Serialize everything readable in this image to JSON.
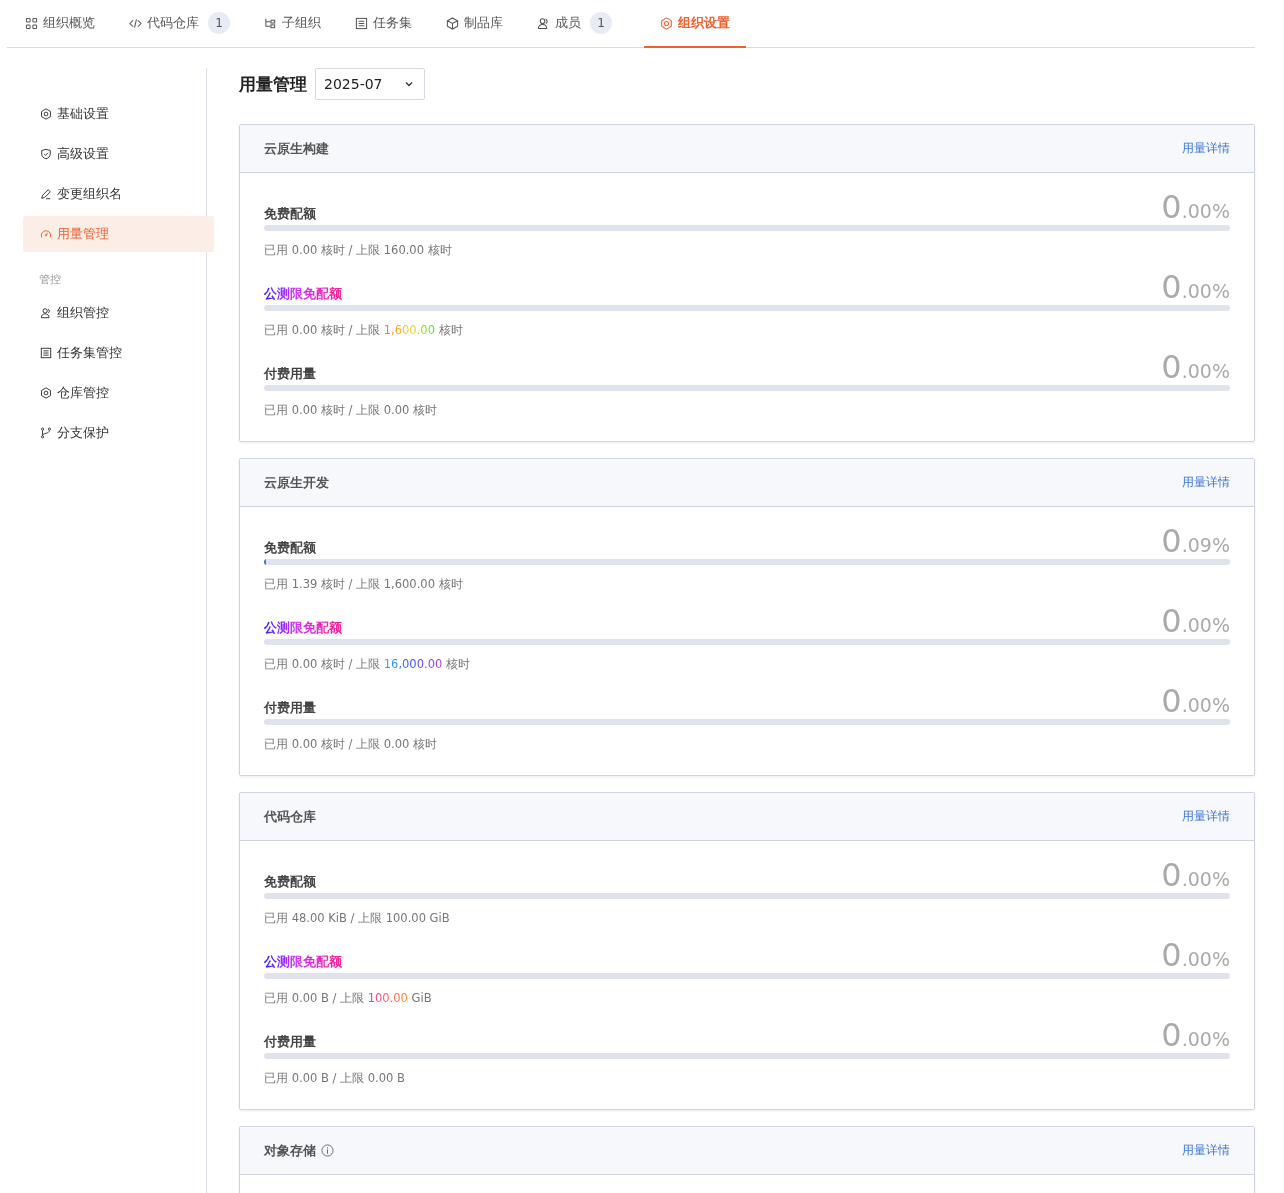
{
  "tabs": [
    {
      "label": "组织概览",
      "selected": false
    },
    {
      "label": "代码仓库",
      "count": "1",
      "selected": false
    },
    {
      "label": "子组织",
      "selected": false
    },
    {
      "label": "任务集",
      "selected": false
    },
    {
      "label": "制品库",
      "selected": false
    },
    {
      "label": "成员",
      "count": "1",
      "selected": false
    },
    {
      "label": "组织设置",
      "selected": true
    }
  ],
  "sidebar": {
    "items": [
      {
        "kind": "item",
        "label": "基础设置",
        "selected": false
      },
      {
        "kind": "item",
        "label": "高级设置",
        "selected": false
      },
      {
        "kind": "item",
        "label": "变更组织名",
        "selected": false
      },
      {
        "kind": "item",
        "label": "用量管理",
        "selected": true
      },
      {
        "kind": "group",
        "label": "管控"
      },
      {
        "kind": "item",
        "label": "组织管控",
        "selected": false
      },
      {
        "kind": "item",
        "label": "任务集管控",
        "selected": false
      },
      {
        "kind": "item",
        "label": "仓库管控",
        "selected": false
      },
      {
        "kind": "item",
        "label": "分支保护",
        "selected": false
      }
    ]
  },
  "page": {
    "title": "用量管理",
    "month": "2025-07"
  },
  "cards": [
    {
      "title": "云原生构建",
      "link": "用量详情",
      "rows": [
        {
          "kind": "standard",
          "label": "免费配额",
          "percent_int": "0",
          "percent_frac": ".00%",
          "level": 0,
          "used": "已用 0.00 核时 / 上限",
          "limit": "160.00",
          "unit": "核时"
        },
        {
          "kind": "promo",
          "label": "公测限免配额",
          "percent_int": "0",
          "percent_frac": ".00%",
          "level": 0,
          "used": "已用 0.00 核时 / 上限",
          "limit": "1,600.00",
          "unit": "核时"
        },
        {
          "kind": "standard",
          "label": "付费用量",
          "percent_int": "0",
          "percent_frac": ".00%",
          "level": 0,
          "used": "已用 0.00 核时 / 上限",
          "limit": "0.00",
          "unit": "核时"
        }
      ]
    },
    {
      "title": "云原生开发",
      "link": "用量详情",
      "rows": [
        {
          "kind": "standard",
          "label": "免费配额",
          "percent_int": "0",
          "percent_frac": ".09%",
          "level": 0.0009,
          "used": "已用 1.39 核时 / 上限",
          "limit": "1,600.00",
          "unit": "核时"
        },
        {
          "kind": "promo",
          "label": "公测限免配额",
          "percent_int": "0",
          "percent_frac": ".00%",
          "level": 0,
          "used": "已用 0.00 核时 / 上限",
          "limit": "16,000.00",
          "unit": "核时"
        },
        {
          "kind": "standard",
          "label": "付费用量",
          "percent_int": "0",
          "percent_frac": ".00%",
          "level": 0,
          "used": "已用 0.00 核时 / 上限",
          "limit": "0.00",
          "unit": "核时"
        }
      ]
    },
    {
      "title": "代码仓库",
      "link": "用量详情",
      "rows": [
        {
          "kind": "standard",
          "label": "免费配额",
          "percent_int": "0",
          "percent_frac": ".00%",
          "level": 0,
          "used": "已用 48.00 KiB / 上限",
          "limit": "100.00",
          "unit": "GiB"
        },
        {
          "kind": "promo",
          "label": "公测限免配额",
          "percent_int": "0",
          "percent_frac": ".00%",
          "level": 0,
          "used": "已用 0.00 B / 上限",
          "limit": "100.00",
          "unit": "GiB"
        },
        {
          "kind": "standard",
          "label": "付费用量",
          "percent_int": "0",
          "percent_frac": ".00%",
          "level": 0,
          "used": "已用 0.00 B / 上限",
          "limit": "0.00",
          "unit": "B"
        }
      ]
    },
    {
      "title": "对象存储",
      "info": true,
      "link": "用量详情"
    }
  ]
}
